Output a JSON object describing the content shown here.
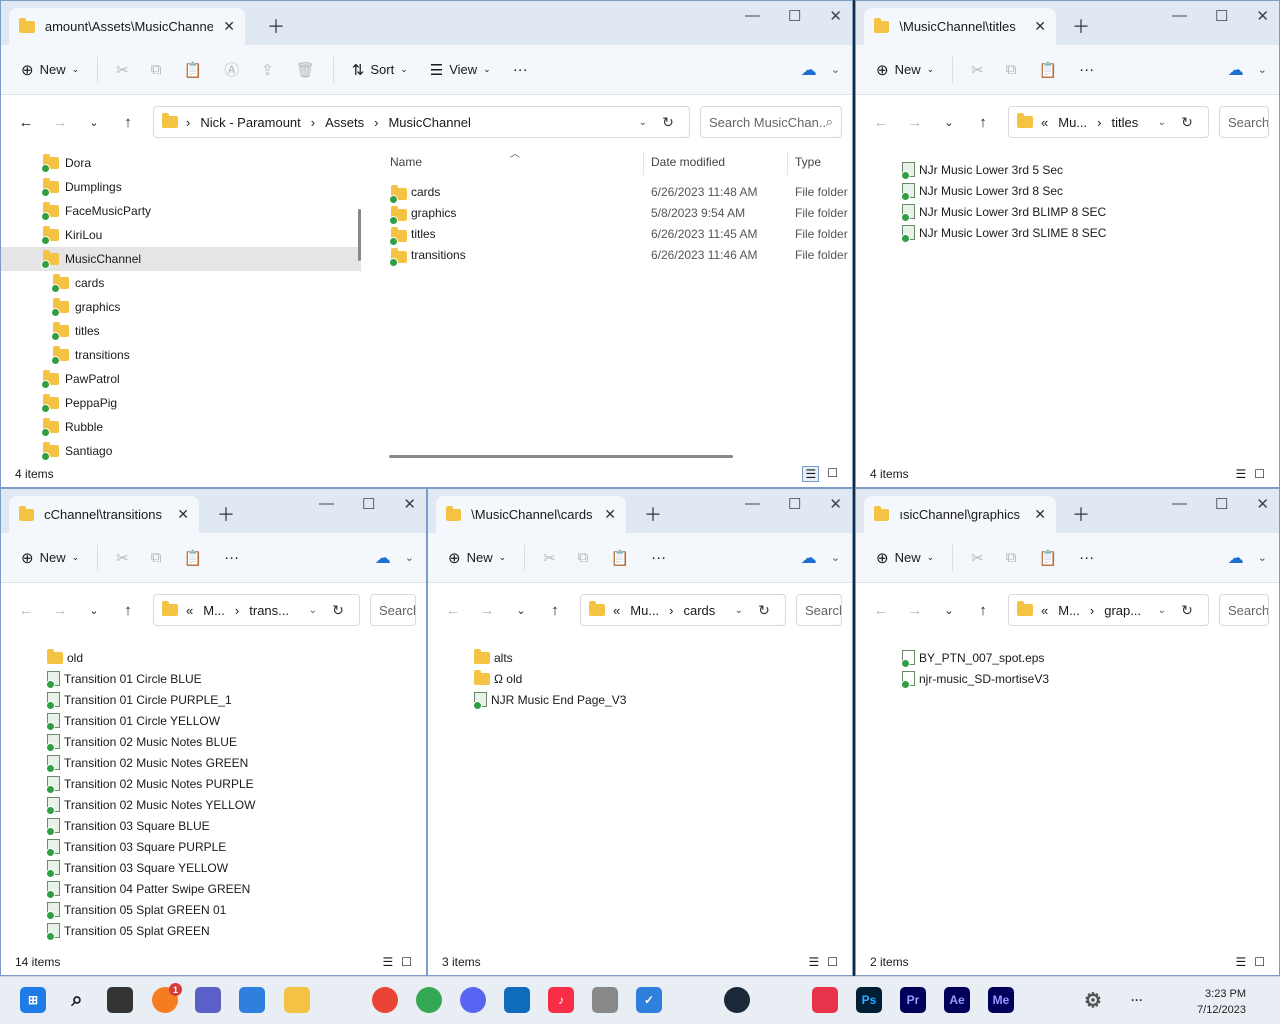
{
  "main": {
    "tab_title": "amount\\Assets\\MusicChannel",
    "toolbar": {
      "new_label": "New",
      "sort_label": "Sort",
      "view_label": "View"
    },
    "breadcrumb": [
      "Nick - Paramount",
      "Assets",
      "MusicChannel"
    ],
    "search_placeholder": "Search MusicChan...",
    "tree": [
      "Dora",
      "Dumplings",
      "FaceMusicParty",
      "KiriLou",
      "MusicChannel",
      "cards",
      "graphics",
      "titles",
      "transitions",
      "PawPatrol",
      "PeppaPig",
      "Rubble",
      "Santiago"
    ],
    "columns": {
      "name": "Name",
      "date": "Date modified",
      "type": "Type"
    },
    "files": [
      {
        "name": "cards",
        "date": "6/26/2023 11:48 AM",
        "type": "File folder"
      },
      {
        "name": "graphics",
        "date": "5/8/2023 9:54 AM",
        "type": "File folder"
      },
      {
        "name": "titles",
        "date": "6/26/2023 11:45 AM",
        "type": "File folder"
      },
      {
        "name": "transitions",
        "date": "6/26/2023 11:46 AM",
        "type": "File folder"
      }
    ],
    "status": "4 items"
  },
  "titles_win": {
    "tab_title": "\\MusicChannel\\titles",
    "new_label": "New",
    "crumbs": [
      "«",
      "Mu...",
      "titles"
    ],
    "search": "Search",
    "items": [
      "NJr Music Lower 3rd 5 Sec",
      "NJr Music Lower 3rd 8 Sec",
      "NJr Music Lower 3rd BLIMP 8 SEC",
      "NJr Music Lower 3rd SLIME 8 SEC"
    ],
    "status": "4 items"
  },
  "transitions_win": {
    "tab_title": "cChannel\\transitions",
    "new_label": "New",
    "crumbs": [
      "«",
      "M...",
      "trans..."
    ],
    "search": "Search",
    "items": [
      "old",
      "Transition 01 Circle BLUE",
      "Transition 01 Circle PURPLE_1",
      "Transition 01 Circle YELLOW",
      "Transition 02 Music Notes BLUE",
      "Transition 02 Music Notes GREEN",
      "Transition 02 Music Notes PURPLE",
      "Transition 02 Music Notes YELLOW",
      "Transition 03 Square BLUE",
      "Transition 03 Square PURPLE",
      "Transition 03 Square YELLOW",
      "Transition 04 Patter Swipe GREEN",
      "Transition 05 Splat GREEN 01",
      "Transition 05 Splat GREEN"
    ],
    "status": "14 items"
  },
  "cards_win": {
    "tab_title": "\\MusicChannel\\cards",
    "new_label": "New",
    "crumbs": [
      "«",
      "Mu...",
      "cards"
    ],
    "search": "Search",
    "items": [
      "alts",
      "Ω old",
      "NJR Music End Page_V3"
    ],
    "status": "3 items"
  },
  "graphics_win": {
    "tab_title": "ısicChannel\\graphics",
    "new_label": "New",
    "crumbs": [
      "«",
      "M...",
      "grap..."
    ],
    "search": "Search",
    "items": [
      "BY_PTN_007_spot.eps",
      "njr-music_SD-mortiseV3"
    ],
    "status": "2 items"
  },
  "taskbar": {
    "time": "3:23 PM",
    "date": "7/12/2023",
    "badge_count": "1",
    "apps": [
      "start-icon",
      "search-icon",
      "task-view-icon",
      "firefox-icon",
      "teams-icon",
      "store-icon",
      "file-explorer-icon",
      "chrome-icon",
      "chrome-icon",
      "discord-icon",
      "outlook-icon",
      "music-icon",
      "apple-icon",
      "todo-icon",
      "steam-icon",
      "creative-cloud-icon",
      "photoshop-icon",
      "premiere-icon",
      "after-effects-icon",
      "media-encoder-icon",
      "settings-icon",
      "more-icon"
    ],
    "app_labels": {
      "ps": "Ps",
      "pr": "Pr",
      "ae": "Ae",
      "me": "Me"
    }
  }
}
